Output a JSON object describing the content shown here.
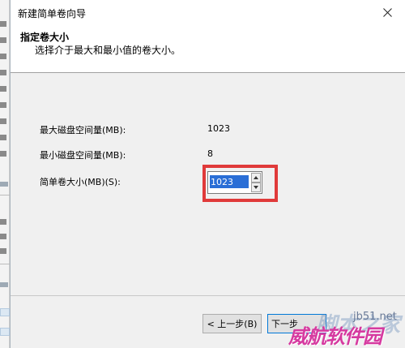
{
  "window": {
    "title": "新建简单卷向导"
  },
  "header": {
    "title": "指定卷大小",
    "subtitle": "选择介于最大和最小值的卷大小。"
  },
  "fields": {
    "max_label": "最大磁盘空间量(MB):",
    "max_value": "1023",
    "min_label": "最小磁盘空间量(MB):",
    "min_value": "8",
    "size_label": "简单卷大小(MB)(S):",
    "size_value": "1023"
  },
  "buttons": {
    "back_label": "< 上一步(B)",
    "next_label": "下一步"
  },
  "watermark": {
    "site": "jb51.net",
    "main": "威航软件园",
    "ghost": "脚本之家"
  },
  "colors": {
    "highlight": "#e03a3a",
    "selection": "#2a6ed6",
    "watermark": "#d63aa0"
  }
}
